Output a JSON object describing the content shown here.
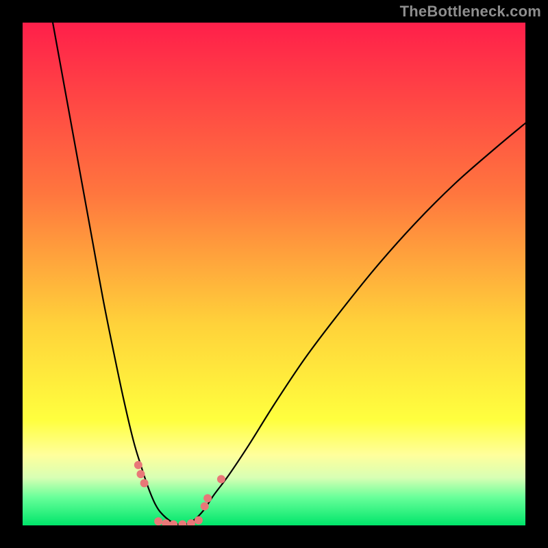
{
  "watermark": "TheBottleneck.com",
  "chart_data": {
    "type": "line",
    "title": "",
    "xlabel": "",
    "ylabel": "",
    "xlim": [
      0,
      100
    ],
    "ylim": [
      0,
      100
    ],
    "gradient_stops": [
      {
        "offset": 0,
        "color": "#ff1f4a"
      },
      {
        "offset": 0.34,
        "color": "#ff763e"
      },
      {
        "offset": 0.6,
        "color": "#ffd23a"
      },
      {
        "offset": 0.79,
        "color": "#ffff3e"
      },
      {
        "offset": 0.86,
        "color": "#ffff9c"
      },
      {
        "offset": 0.905,
        "color": "#d8ffb4"
      },
      {
        "offset": 0.945,
        "color": "#66ff99"
      },
      {
        "offset": 1.0,
        "color": "#00e56a"
      }
    ],
    "series": [
      {
        "name": "left-curve",
        "x": [
          6,
          8,
          10,
          12,
          14,
          16,
          18,
          20,
          22,
          23.5,
          25,
          26.5,
          28,
          30,
          32
        ],
        "y": [
          100,
          89,
          78,
          67,
          56,
          45,
          35,
          25.5,
          17,
          12,
          7.5,
          4,
          2,
          0.5,
          0
        ]
      },
      {
        "name": "right-curve",
        "x": [
          32,
          34,
          36,
          38,
          41,
          45,
          50,
          56,
          62,
          70,
          78,
          86,
          94,
          100
        ],
        "y": [
          0,
          1,
          3,
          6,
          10,
          16,
          24,
          33,
          41,
          51,
          60,
          68,
          75,
          80
        ]
      }
    ],
    "markers": [
      {
        "x": 23.0,
        "y": 12.0,
        "r": 6
      },
      {
        "x": 23.5,
        "y": 10.2,
        "r": 6
      },
      {
        "x": 24.2,
        "y": 8.4,
        "r": 6
      },
      {
        "x": 27.0,
        "y": 0.8,
        "r": 6
      },
      {
        "x": 28.5,
        "y": 0.4,
        "r": 6
      },
      {
        "x": 30.0,
        "y": 0.2,
        "r": 6
      },
      {
        "x": 31.8,
        "y": 0.2,
        "r": 6
      },
      {
        "x": 33.5,
        "y": 0.4,
        "r": 6
      },
      {
        "x": 35.0,
        "y": 1.0,
        "r": 6
      },
      {
        "x": 36.2,
        "y": 3.8,
        "r": 6
      },
      {
        "x": 36.8,
        "y": 5.4,
        "r": 6
      },
      {
        "x": 39.5,
        "y": 9.2,
        "r": 6
      }
    ],
    "marker_color": "#e87878"
  }
}
